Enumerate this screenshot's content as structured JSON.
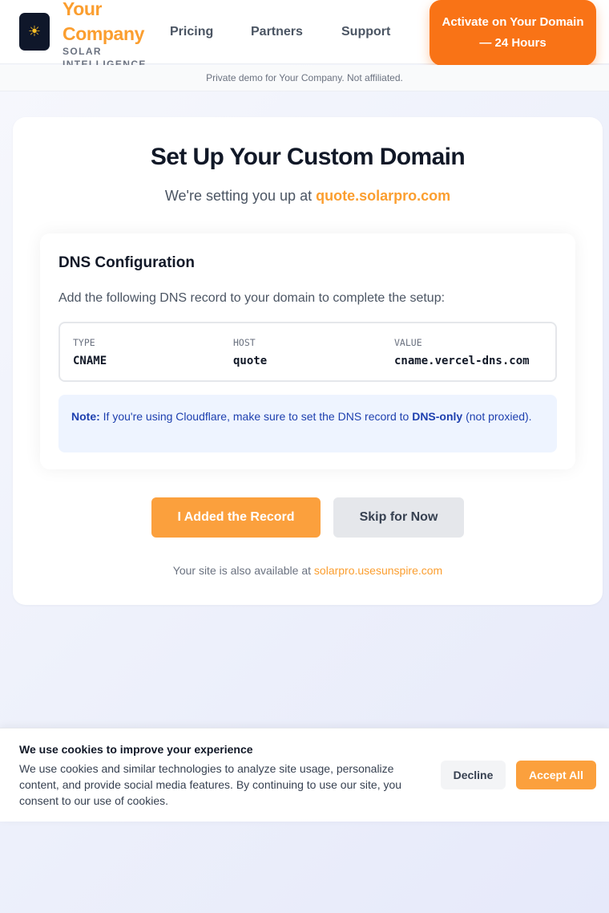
{
  "header": {
    "logo_icon": "sun-icon",
    "brand_name": "Your Company",
    "tagline": "SOLAR INTELLIGENCE",
    "nav": [
      {
        "label": "Pricing"
      },
      {
        "label": "Partners"
      },
      {
        "label": "Support"
      }
    ],
    "cta_label": "Activate on Your Domain — 24 Hours"
  },
  "demo_notice": "Private demo for Your Company. Not affiliated.",
  "main": {
    "title": "Set Up Your Custom Domain",
    "subtitle_prefix": "We're setting you up at ",
    "subtitle_domain": "quote.solarpro.com",
    "dns": {
      "title": "DNS Configuration",
      "description": "Add the following DNS record to your domain to complete the setup:",
      "record": {
        "type_label": "TYPE",
        "type_value": "CNAME",
        "host_label": "HOST",
        "host_value": "quote",
        "value_label": "VALUE",
        "value_value": "cname.vercel-dns.com"
      },
      "note": {
        "label": "Note:",
        "text_before": " If you're using Cloudflare, make sure to set the DNS record to ",
        "emphasis": "DNS-only",
        "text_after": " (not proxied)."
      }
    },
    "primary_button": "I Added the Record",
    "secondary_button": "Skip for Now",
    "alt_prefix": "Your site is also available at ",
    "alt_domain": "solarpro.usesunspire.com"
  },
  "cookie": {
    "title": "We use cookies to improve your experience",
    "text": "We use cookies and similar technologies to analyze site usage, personalize content, and provide social media features. By continuing to use our site, you consent to our use of cookies.",
    "decline_label": "Decline",
    "accept_label": "Accept All"
  },
  "colors": {
    "accent": "#fb9e2f",
    "cta": "#f97316",
    "note_text": "#1e40af",
    "note_bg": "#eef4ff"
  }
}
